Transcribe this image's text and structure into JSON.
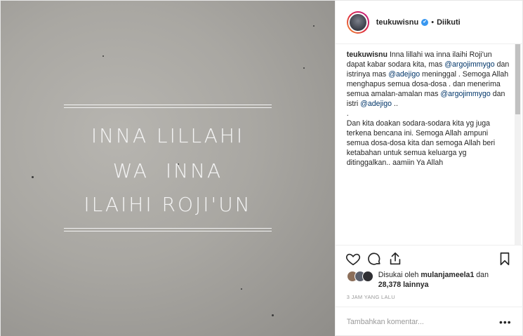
{
  "post_image": {
    "quote_lines": [
      "INNA LILLAHI",
      "WA  INNA",
      "ILAIHI ROJI'UN"
    ]
  },
  "header": {
    "username": "teukuwisnu",
    "verified_mark": "✔",
    "separator": "•",
    "follow_status": "Diikuti"
  },
  "caption": {
    "username": "teukuwisnu",
    "p1_a": " Inna lillahi wa inna ilaihi Roji'un dapat kabar sodara kita, mas ",
    "mention1": "@argojimmygo",
    "p1_b": " dan istrinya mas ",
    "mention2": "@adejigo",
    "p1_c": " meninggal . Semoga Allah menghapus semua dosa-dosa . dan menerima semua amalan-amalan mas ",
    "mention3": "@argojimmygo",
    "p1_d": " dan istri ",
    "mention4": "@adejigo",
    "p1_e": " ..",
    "p2": ".",
    "p3": "Dan kita doakan sodara-sodara kita yg juga terkena bencana ini. Semoga Allah ampuni semua dosa-dosa kita dan semoga Allah beri ketabahan untuk semua keluarga yg ditinggalkan.. aamiin Ya Allah"
  },
  "actions": {
    "like_icon": "heart-icon",
    "comment_icon": "comment-icon",
    "share_icon": "share-icon",
    "save_icon": "bookmark-icon"
  },
  "likes": {
    "prefix": "Disukai oleh ",
    "liker": "mulanjameela1",
    "connector": " dan",
    "count": "28,378",
    "suffix": " lainnya"
  },
  "timestamp": "3 JAM YANG LALU",
  "comment": {
    "placeholder": "Tambahkan komentar...",
    "more_label": "•••"
  },
  "colors": {
    "mention": "#003569",
    "verified": "#3897f0",
    "muted": "#999999"
  }
}
